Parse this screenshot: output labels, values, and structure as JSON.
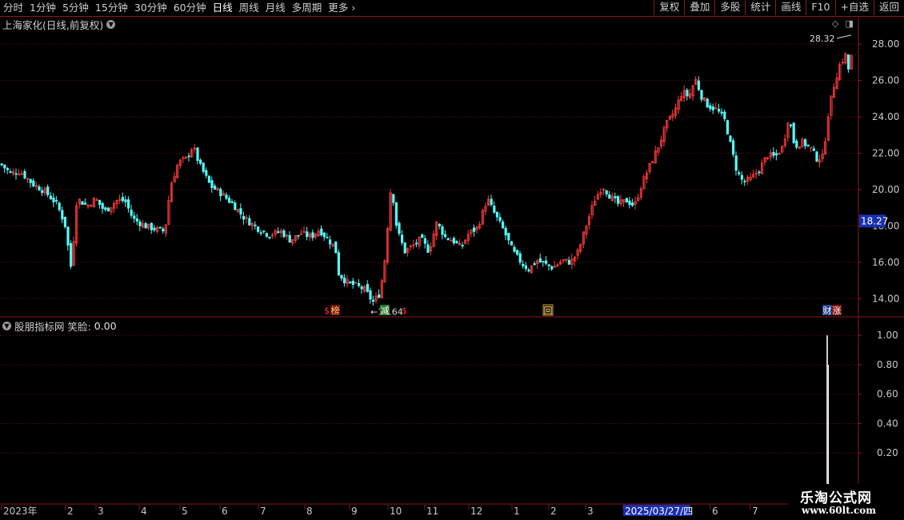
{
  "toolbar": {
    "periods": [
      "分时",
      "1分钟",
      "5分钟",
      "15分钟",
      "30分钟",
      "60分钟",
      "日线",
      "周线",
      "月线",
      "多周期",
      "更多"
    ],
    "active_period": "日线",
    "more_arrow": "›",
    "actions": [
      "复权",
      "叠加",
      "多股",
      "统计",
      "画线",
      "F10",
      "+自选",
      "返回"
    ]
  },
  "stock": {
    "title": "上海家化(日线,前复权)",
    "high_marker": "28.32",
    "low_marker": "13.64",
    "current_price": "18.27"
  },
  "signals": [
    {
      "label": "$",
      "color": "#ff3030",
      "bg": "none"
    },
    {
      "label": "榜",
      "color": "#ffd45a",
      "bg": "#7a1010"
    },
    {
      "label": "减",
      "color": "#fff",
      "bg": "#2a7a2a"
    },
    {
      "label": "$",
      "color": "#ff3030",
      "bg": "none"
    },
    {
      "label": "回",
      "color": "#ffd45a",
      "bg": "#1a1a1a"
    },
    {
      "label": "财",
      "color": "#fff",
      "bg": "#1f3f8f"
    },
    {
      "label": "涨",
      "color": "#fff",
      "bg": "#8b1010"
    }
  ],
  "indicator": {
    "source": "股朋指标网",
    "name": "笑脸:",
    "value": "0.00"
  },
  "x_axis": {
    "labels": [
      "2023年",
      "2",
      "3",
      "4",
      "5",
      "6",
      "7",
      "8",
      "9",
      "10",
      "11",
      "12",
      "1",
      "2",
      "3",
      "2025/03/27/四",
      "6",
      "7"
    ]
  },
  "watermark": {
    "line1": "乐淘公式网",
    "line2": "www.60lt.com"
  },
  "colors": {
    "up": "#ff3c3c",
    "down": "#54fcfc",
    "grid": "#7a1010",
    "axis": "#8b1a1a",
    "price_tag_bg": "#1a2fb0"
  },
  "chart_data": [
    {
      "type": "candlestick",
      "title": "上海家化(日线,前复权)",
      "y_ticks": [
        "28.00",
        "26.00",
        "24.00",
        "22.00",
        "20.00",
        "18.00",
        "16.00",
        "14.00"
      ],
      "ylim": [
        13.0,
        28.8
      ],
      "trend_points": [
        [
          0,
          21.4
        ],
        [
          12,
          20.9
        ],
        [
          24,
          21.0
        ],
        [
          40,
          20.3
        ],
        [
          55,
          19.9
        ],
        [
          70,
          19.2
        ],
        [
          80,
          18.1
        ],
        [
          88,
          15.6
        ],
        [
          95,
          19.5
        ],
        [
          108,
          19.1
        ],
        [
          118,
          19.5
        ],
        [
          130,
          18.8
        ],
        [
          145,
          19.4
        ],
        [
          155,
          19.4
        ],
        [
          165,
          18.4
        ],
        [
          180,
          18.0
        ],
        [
          195,
          17.8
        ],
        [
          205,
          17.7
        ],
        [
          212,
          20.2
        ],
        [
          222,
          21.5
        ],
        [
          232,
          21.7
        ],
        [
          240,
          22.4
        ],
        [
          248,
          21.4
        ],
        [
          262,
          20.2
        ],
        [
          275,
          19.8
        ],
        [
          290,
          19.2
        ],
        [
          305,
          18.4
        ],
        [
          320,
          17.9
        ],
        [
          335,
          17.5
        ],
        [
          350,
          17.7
        ],
        [
          362,
          17.2
        ],
        [
          375,
          17.6
        ],
        [
          388,
          17.4
        ],
        [
          398,
          17.8
        ],
        [
          410,
          17.2
        ],
        [
          418,
          16.8
        ],
        [
          422,
          15.4
        ],
        [
          432,
          14.9
        ],
        [
          445,
          14.7
        ],
        [
          455,
          14.5
        ],
        [
          465,
          13.8
        ],
        [
          474,
          14.3
        ],
        [
          480,
          16.2
        ],
        [
          488,
          20.4
        ],
        [
          495,
          17.8
        ],
        [
          505,
          16.6
        ],
        [
          515,
          16.9
        ],
        [
          525,
          17.3
        ],
        [
          535,
          16.6
        ],
        [
          545,
          18.2
        ],
        [
          555,
          17.4
        ],
        [
          565,
          17.2
        ],
        [
          575,
          16.8
        ],
        [
          585,
          17.6
        ],
        [
          596,
          17.9
        ],
        [
          608,
          19.5
        ],
        [
          618,
          18.6
        ],
        [
          628,
          17.8
        ],
        [
          640,
          16.6
        ],
        [
          652,
          15.9
        ],
        [
          660,
          15.6
        ],
        [
          670,
          16.1
        ],
        [
          680,
          15.9
        ],
        [
          690,
          15.7
        ],
        [
          702,
          16.1
        ],
        [
          712,
          16.0
        ],
        [
          722,
          16.6
        ],
        [
          730,
          17.8
        ],
        [
          742,
          19.4
        ],
        [
          752,
          20.2
        ],
        [
          762,
          19.6
        ],
        [
          772,
          19.2
        ],
        [
          782,
          19.4
        ],
        [
          792,
          19.1
        ],
        [
          802,
          20.4
        ],
        [
          812,
          21.4
        ],
        [
          822,
          22.4
        ],
        [
          832,
          23.6
        ],
        [
          842,
          24.3
        ],
        [
          852,
          25.4
        ],
        [
          860,
          25.1
        ],
        [
          868,
          26.1
        ],
        [
          876,
          25.1
        ],
        [
          884,
          24.6
        ],
        [
          895,
          24.4
        ],
        [
          905,
          23.8
        ],
        [
          914,
          22.1
        ],
        [
          920,
          21.0
        ],
        [
          928,
          20.4
        ],
        [
          938,
          20.6
        ],
        [
          948,
          21.1
        ],
        [
          958,
          21.9
        ],
        [
          968,
          21.8
        ],
        [
          978,
          22.4
        ],
        [
          985,
          24.1
        ],
        [
          992,
          22.4
        ],
        [
          1002,
          22.6
        ],
        [
          1012,
          22.3
        ],
        [
          1020,
          21.7
        ],
        [
          1028,
          21.8
        ],
        [
          1034,
          24.1
        ],
        [
          1040,
          25.5
        ],
        [
          1048,
          26.8
        ],
        [
          1056,
          27.4
        ],
        [
          1060,
          26.5
        ],
        [
          1066,
          28.1
        ]
      ]
    },
    {
      "type": "bar",
      "title": "笑脸",
      "y_ticks": [
        "1.00",
        "0.80",
        "0.60",
        "0.40",
        "0.20"
      ],
      "ylim": [
        0,
        1.05
      ],
      "series": [
        {
          "name": "笑脸",
          "x_index": 1034,
          "value": 1.0
        }
      ]
    }
  ]
}
